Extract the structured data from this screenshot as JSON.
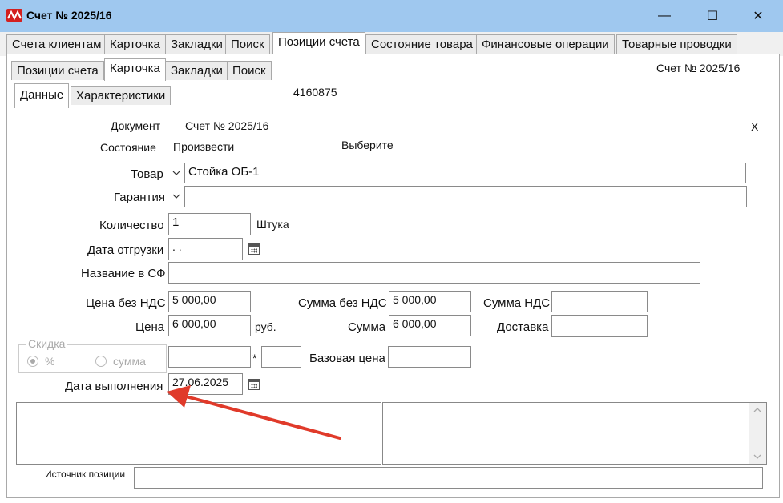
{
  "window": {
    "title": "Счет № 2025/16",
    "minimize": "—",
    "maximize": "☐",
    "close": "✕"
  },
  "main_tabs": [
    "Счета клиентам",
    "Карточка",
    "Закладки",
    "Поиск",
    "Позиции счета",
    "Состояние товара",
    "Финансовые операции",
    "Товарные проводки"
  ],
  "sub_tabs": [
    "Позиции счета",
    "Карточка",
    "Закладки",
    "Поиск"
  ],
  "inner_tabs": [
    "Данные",
    "Характеристики"
  ],
  "header": {
    "invoice": "Счет № 2025/16",
    "code": "4160875"
  },
  "form": {
    "doc_label": "Документ",
    "doc_value": "Счет № 2025/16",
    "close_x": "X",
    "state_label": "Состояние",
    "state_value": "Произвести",
    "choose": "Выберите",
    "goods_label": "Товар",
    "goods_value": "Стойка ОБ-1",
    "warranty_label": "Гарантия",
    "warranty_value": "",
    "qty_label": "Количество",
    "qty_value": "1",
    "unit": "Штука",
    "ship_date_label": "Дата отгрузки",
    "ship_date_value": " .  .",
    "invoice_name_label": "Название в СФ",
    "invoice_name_value": "",
    "price_no_vat_label": "Цена без НДС",
    "price_no_vat_value": "5 000,00",
    "sum_no_vat_label": "Сумма без НДС",
    "sum_no_vat_value": "5 000,00",
    "vat_sum_label": "Сумма НДС",
    "vat_sum_value": "",
    "price_label": "Цена",
    "price_value": "6 000,00",
    "currency": "руб.",
    "sum_label": "Сумма",
    "sum_value": "6 000,00",
    "delivery_label": "Доставка",
    "delivery_value": "",
    "discount_label": "Скидка",
    "discount_percent": "%",
    "discount_sum": "сумма",
    "discount_value": "",
    "multiplier": "*",
    "multiplier_value": "",
    "base_price_label": "Базовая цена",
    "base_price_value": "",
    "done_date_label": "Дата выполнения",
    "done_date_value": "27.06.2025",
    "source_label": "Источник позиции",
    "source_value": ""
  },
  "colors": {
    "titlebar": "#9fc8ef",
    "arrow": "#e03a2a"
  }
}
